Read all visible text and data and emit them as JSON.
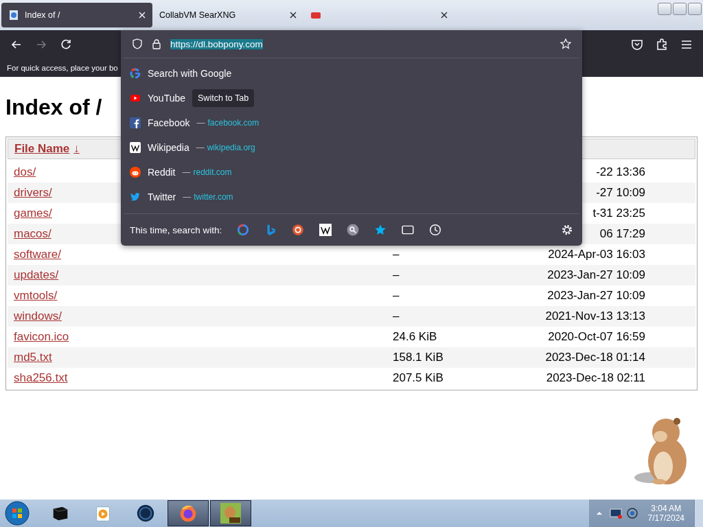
{
  "tabs": [
    {
      "title": "Index of /",
      "selected": true,
      "kind": "page"
    },
    {
      "title": "CollabVM SearXNG",
      "selected": false,
      "kind": "none"
    },
    {
      "selected": false,
      "kind": "red"
    }
  ],
  "toolbar": {
    "url": "https://dl.bobpony.com"
  },
  "bookmarks_bar": {
    "text": "For quick access, place your bo"
  },
  "url_dropdown": {
    "results": [
      {
        "title": "Search with Google",
        "kind": "google"
      },
      {
        "title": "YouTube",
        "badge": "Switch to Tab",
        "kind": "youtube"
      },
      {
        "title": "Facebook",
        "url": "facebook.com",
        "kind": "facebook"
      },
      {
        "title": "Wikipedia",
        "url": "wikipedia.org",
        "kind": "wikipedia"
      },
      {
        "title": "Reddit",
        "url": "reddit.com",
        "kind": "reddit"
      },
      {
        "title": "Twitter",
        "url": "twitter.com",
        "kind": "twitter"
      }
    ],
    "separator": "—",
    "footer_label": "This time, search with:"
  },
  "page": {
    "heading": "Index of /",
    "table": {
      "columns": [
        {
          "label": "File Name",
          "sort_mark": "↓"
        }
      ],
      "rows": [
        {
          "name": "dos/",
          "date": "-22 13:36"
        },
        {
          "name": "drivers/",
          "date": "-27 10:09"
        },
        {
          "name": "games/",
          "date": "t-31 23:25"
        },
        {
          "name": "macos/",
          "date": "06 17:29"
        },
        {
          "name": "software/",
          "size": "–",
          "date": "2024-Apr-03 16:03"
        },
        {
          "name": "updates/",
          "size": "–",
          "date": "2023-Jan-27 10:09"
        },
        {
          "name": "vmtools/",
          "size": "–",
          "date": "2023-Jan-27 10:09"
        },
        {
          "name": "windows/",
          "size": "–",
          "date": "2021-Nov-13 13:13"
        },
        {
          "name": "favicon.ico",
          "size": "24.6 KiB",
          "date": "2020-Oct-07 16:59"
        },
        {
          "name": "md5.txt",
          "size": "158.1 KiB",
          "date": "2023-Dec-18 01:14"
        },
        {
          "name": "sha256.txt",
          "size": "207.5 KiB",
          "date": "2023-Dec-18 02:11"
        }
      ]
    }
  },
  "taskbar": {
    "apps": [
      {
        "kind": "terminal",
        "selected": false
      },
      {
        "kind": "media",
        "selected": false
      },
      {
        "kind": "globe",
        "selected": false
      },
      {
        "kind": "firefox",
        "selected": true
      },
      {
        "kind": "hamster",
        "selected": true
      }
    ],
    "clock": {
      "time": "3:04 AM",
      "date": "7/17/2024"
    }
  }
}
